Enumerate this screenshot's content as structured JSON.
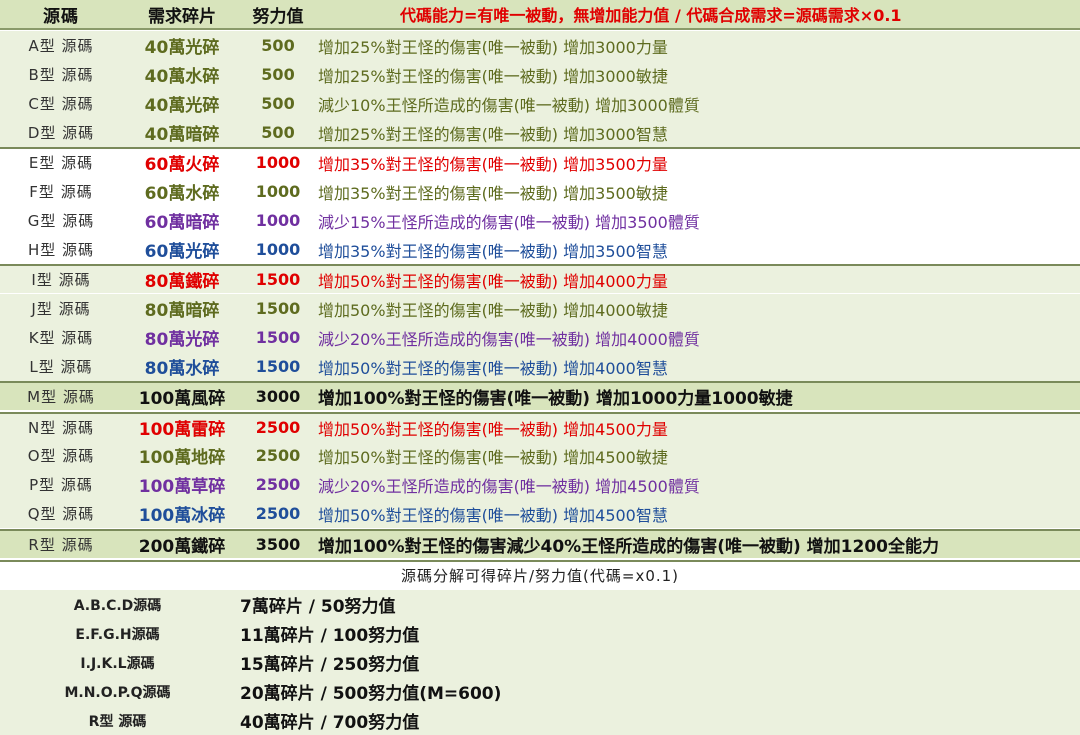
{
  "header": {
    "col1": "源碼",
    "col2": "需求碎片",
    "col3": "努力值",
    "note": "代碼能力=有唯一被動，無增加能力值 / 代碼合成需求=源碼需求×0.1"
  },
  "colors": {
    "header_bg": "#d8e4bc",
    "band_light": "#ebf1de",
    "band_olive": "#d8e4bc",
    "red": "#e00000",
    "olive_text": "#5e6b1f",
    "purple": "#7030a0",
    "blue": "#1f4e9a",
    "black": "#111111"
  },
  "rows": [
    {
      "code": "A型 源碼",
      "shards": "40萬光碎",
      "effort": "500",
      "desc": "增加25%對王怪的傷害(唯一被動) 增加3000力量",
      "color": "olive"
    },
    {
      "code": "B型 源碼",
      "shards": "40萬水碎",
      "effort": "500",
      "desc": "增加25%對王怪的傷害(唯一被動) 增加3000敏捷",
      "color": "olive"
    },
    {
      "code": "C型 源碼",
      "shards": "40萬光碎",
      "effort": "500",
      "desc": "減少10%王怪所造成的傷害(唯一被動) 增加3000體質",
      "color": "olive"
    },
    {
      "code": "D型 源碼",
      "shards": "40萬暗碎",
      "effort": "500",
      "desc": "增加25%對王怪的傷害(唯一被動) 增加3000智慧",
      "color": "olive"
    },
    {
      "code": "E型 源碼",
      "shards": "60萬火碎",
      "effort": "1000",
      "desc": "增加35%對王怪的傷害(唯一被動) 增加3500力量",
      "color": "red"
    },
    {
      "code": "F型 源碼",
      "shards": "60萬水碎",
      "effort": "1000",
      "desc": "增加35%對王怪的傷害(唯一被動) 增加3500敏捷",
      "color": "olive"
    },
    {
      "code": "G型 源碼",
      "shards": "60萬暗碎",
      "effort": "1000",
      "desc": "減少15%王怪所造成的傷害(唯一被動) 增加3500體質",
      "color": "purple"
    },
    {
      "code": "H型 源碼",
      "shards": "60萬光碎",
      "effort": "1000",
      "desc": "增加35%對王怪的傷害(唯一被動) 增加3500智慧",
      "color": "blue"
    },
    {
      "code": "I型 源碼",
      "shards": "80萬鐵碎",
      "effort": "1500",
      "desc": "增加50%對王怪的傷害(唯一被動) 增加4000力量",
      "color": "red"
    },
    {
      "code": "J型 源碼",
      "shards": "80萬暗碎",
      "effort": "1500",
      "desc": "增加50%對王怪的傷害(唯一被動) 增加4000敏捷",
      "color": "olive"
    },
    {
      "code": "K型 源碼",
      "shards": "80萬光碎",
      "effort": "1500",
      "desc": "減少20%王怪所造成的傷害(唯一被動) 增加4000體質",
      "color": "purple"
    },
    {
      "code": "L型 源碼",
      "shards": "80萬水碎",
      "effort": "1500",
      "desc": "增加50%對王怪的傷害(唯一被動) 增加4000智慧",
      "color": "blue"
    },
    {
      "code": "M型 源碼",
      "shards": "100萬風碎",
      "effort": "3000",
      "desc": "增加100%對王怪的傷害(唯一被動) 增加1000力量1000敏捷",
      "color": "black"
    },
    {
      "code": "N型 源碼",
      "shards": "100萬雷碎",
      "effort": "2500",
      "desc": "增加50%對王怪的傷害(唯一被動) 增加4500力量",
      "color": "red"
    },
    {
      "code": "O型 源碼",
      "shards": "100萬地碎",
      "effort": "2500",
      "desc": "增加50%對王怪的傷害(唯一被動) 增加4500敏捷",
      "color": "olive"
    },
    {
      "code": "P型 源碼",
      "shards": "100萬草碎",
      "effort": "2500",
      "desc": "減少20%王怪所造成的傷害(唯一被動) 增加4500體質",
      "color": "purple"
    },
    {
      "code": "Q型 源碼",
      "shards": "100萬冰碎",
      "effort": "2500",
      "desc": "增加50%對王怪的傷害(唯一被動) 增加4500智慧",
      "color": "blue"
    },
    {
      "code": "R型 源碼",
      "shards": "200萬鐵碎",
      "effort": "3500",
      "desc": "增加100%對王怪的傷害減少40%王怪所造成的傷害(唯一被動) 增加1200全能力",
      "color": "black"
    }
  ],
  "summary": {
    "title": "源碼分解可得碎片/努力值(代碼=x0.1)",
    "items": [
      {
        "label": "A.B.C.D源碼",
        "value": "7萬碎片 / 50努力值"
      },
      {
        "label": "E.F.G.H源碼",
        "value": "11萬碎片 / 100努力值"
      },
      {
        "label": "I.J.K.L源碼",
        "value": "15萬碎片 / 250努力值"
      },
      {
        "label": "M.N.O.P.Q源碼",
        "value": "20萬碎片 / 500努力值(M=600)"
      },
      {
        "label": "R型 源碼",
        "value": "40萬碎片 / 700努力值"
      }
    ]
  }
}
